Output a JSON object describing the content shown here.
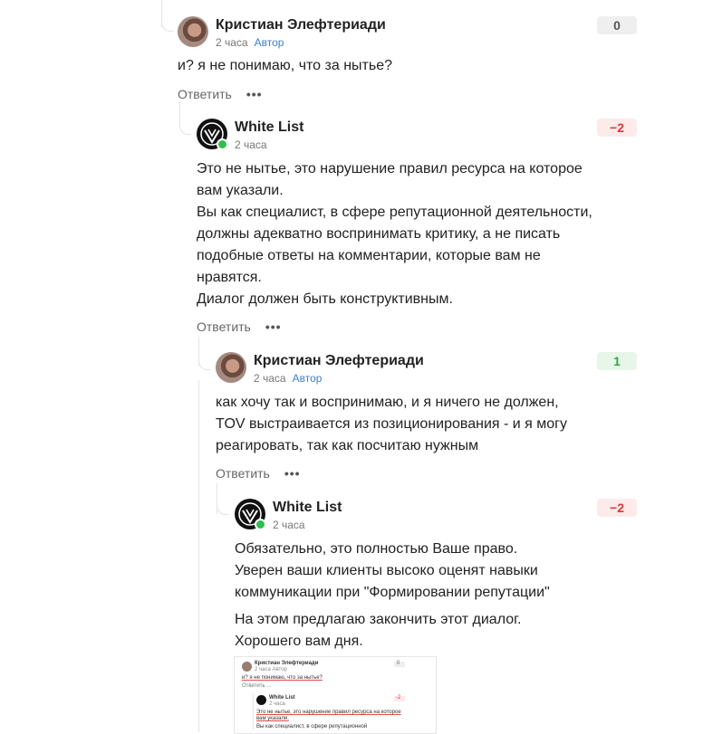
{
  "comments": [
    {
      "author": "Кристиан Элефтериади",
      "time": "2 часа",
      "tag": "Автор",
      "score": "0",
      "avatar_icon": "user-avatar-icon",
      "text": [
        "и? я не понимаю, что за нытье?"
      ]
    },
    {
      "author": "White List",
      "time": "2 часа",
      "score": "−2",
      "avatar_icon": "white-list-logo-icon",
      "text": [
        "Это не нытье, это нарушение правил ресурса на которое вам указали.",
        "Вы как специалист, в сфере репутационной деятельности, должны адекватно воспринимать критику, а не писать подобные ответы на комментарии, которые вам не нравятся.",
        "Диалог должен быть конструктивным."
      ]
    },
    {
      "author": "Кристиан Элефтериади",
      "time": "2 часа",
      "tag": "Автор",
      "score": "1",
      "avatar_icon": "user-avatar-icon",
      "text": [
        "как хочу так и воспринимаю, и я ничего не должен, TOV выстраивается из позиционирования - и я могу реагировать, так как посчитаю нужным"
      ]
    },
    {
      "author": "White List",
      "time": "2 часа",
      "score": "−2",
      "avatar_icon": "white-list-logo-icon",
      "text": [
        "Обязательно, это полностью Ваше право.",
        "Уверен ваши клиенты высоко оценят навыки коммуникации при \"Формировании репутации\"",
        "На этом предлагаю закончить этот диалог.",
        "Хорошего вам дня."
      ]
    }
  ],
  "actions": {
    "reply": "Ответить",
    "more": "•••"
  },
  "colors": {
    "positive": "#33a64a",
    "negative": "#d63b3b",
    "author_tag": "#3f82c8",
    "online": "#2fbf4f"
  },
  "attachment": {
    "author_1": "Кристиан Элефтериади",
    "meta_1": "2 часа  Автор",
    "badge_1": "0",
    "text_1": "и? я не понимаю, что за нытье?",
    "actions_1": "Ответить  ...",
    "author_2": "White List",
    "meta_2": "2 часа",
    "badge_2": "-2",
    "text_2": "Это не нытье, это нарушение правил ресурса на которое вам указали.",
    "text_3": "Вы как специалист, в сфере репутационной"
  }
}
